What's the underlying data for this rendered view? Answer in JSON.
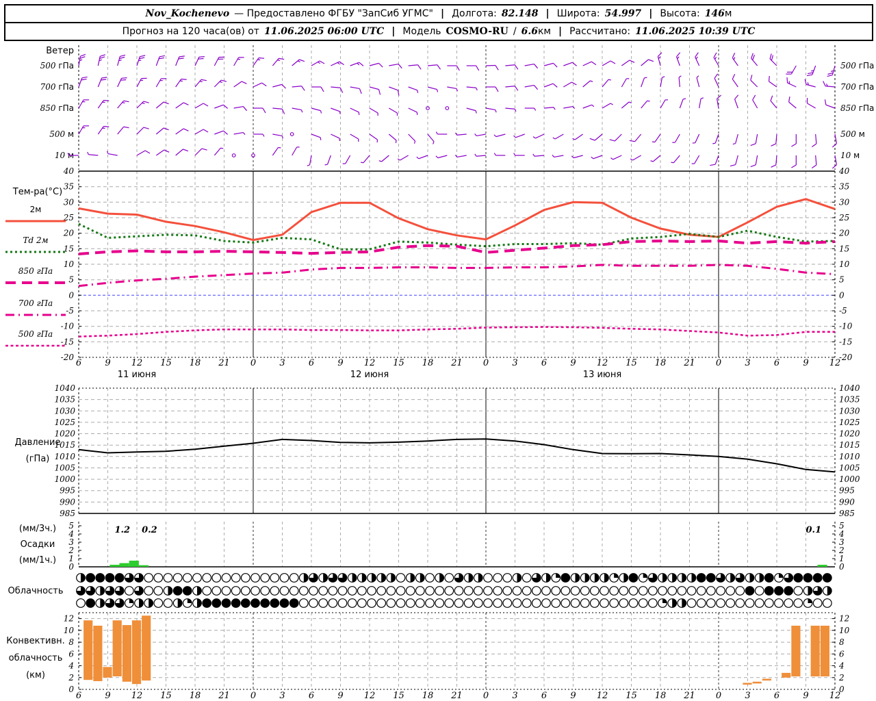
{
  "header": {
    "station": "Nov_Kochenevo",
    "provider": "— Предоставлено ФГБУ \"ЗапСиб УГМС\"",
    "separator": "|",
    "lon_label": "Долгота:",
    "lon": "82.148",
    "lat_label": "Широта:",
    "lat": "54.997",
    "alt_label": "Высота:",
    "alt_num": "146",
    "alt_unit": "м",
    "forecast_label": "Прогноз на 120 часа(ов) от",
    "forecast_start": "11.06.2025 06:00 UTC",
    "model_label": "Модель",
    "model": "COSMO-RU",
    "model_slash": "/",
    "model_res_num": "6.6",
    "model_res_unit": "км",
    "calc_label": "Рассчитано:",
    "calc_time": "11.06.2025 10:39 UTC"
  },
  "colors": {
    "barb": "#8a00c8",
    "temp_2m": "#f4503c",
    "dewpoint": "#157815",
    "magenta": "#e6008c",
    "zero_line": "#4444ff",
    "grid": "#aaaaaa",
    "pressure_line": "#000000",
    "precip_bar": "#2ecc2e",
    "conv_bar": "#ef8f3a"
  },
  "chart_data": {
    "type": "meteogram",
    "x_axis": {
      "start_label_hour": 6,
      "span_hours": 78,
      "tick_step_hours": 3,
      "hour_labels": [
        "6",
        "9",
        "12",
        "15",
        "18",
        "21",
        "0",
        "3",
        "6",
        "9",
        "12",
        "15",
        "18",
        "21",
        "0",
        "3",
        "6",
        "9",
        "12",
        "15",
        "18",
        "21",
        "0",
        "3",
        "6",
        "9",
        "12"
      ],
      "date_labels": [
        {
          "text": "11 июня",
          "t": 6
        },
        {
          "text": "12 июня",
          "t": 30
        },
        {
          "text": "13 июня",
          "t": 54
        }
      ]
    },
    "wind": {
      "title": "Ветер",
      "levels": [
        "500 гПа",
        "700 гПа",
        "850 гПа",
        "500 м",
        "10 м"
      ],
      "barb_step_hours": 2,
      "barbs": [
        {
          "level": "500 гПа",
          "dirs": [
            10,
            12,
            15,
            18,
            20,
            22,
            25,
            28,
            30,
            35,
            40,
            50,
            60,
            65,
            70,
            75,
            80,
            85,
            85,
            90,
            90,
            88,
            85,
            80,
            75,
            70,
            65,
            60,
            55,
            50,
            345,
            340,
            335,
            330,
            325,
            320,
            315,
            210,
            200,
            195
          ],
          "spds": [
            25,
            25,
            25,
            25,
            20,
            20,
            20,
            20,
            15,
            15,
            15,
            15,
            15,
            15,
            15,
            10,
            10,
            10,
            10,
            10,
            10,
            10,
            10,
            10,
            10,
            10,
            10,
            10,
            10,
            10,
            15,
            15,
            15,
            15,
            15,
            20,
            20,
            20,
            25,
            25
          ]
        },
        {
          "level": "700 гПа",
          "dirs": [
            20,
            22,
            25,
            28,
            30,
            35,
            40,
            45,
            55,
            65,
            75,
            85,
            90,
            95,
            100,
            105,
            110,
            110,
            105,
            100,
            95,
            90,
            85,
            80,
            70,
            60,
            50,
            40,
            30,
            20,
            10,
            355,
            345,
            335,
            325,
            315,
            305,
            295,
            285,
            275
          ],
          "spds": [
            20,
            20,
            20,
            15,
            15,
            15,
            15,
            15,
            10,
            10,
            10,
            10,
            10,
            10,
            10,
            10,
            10,
            5,
            5,
            5,
            5,
            10,
            10,
            10,
            10,
            10,
            5,
            5,
            5,
            5,
            5,
            5,
            5,
            10,
            10,
            10,
            10,
            15,
            15,
            15
          ]
        },
        {
          "level": "850 гПа",
          "dirs": [
            30,
            35,
            40,
            45,
            50,
            55,
            60,
            70,
            80,
            90,
            95,
            100,
            105,
            110,
            115,
            120,
            120,
            115,
            0,
            0,
            105,
            100,
            95,
            90,
            85,
            80,
            70,
            60,
            50,
            40,
            30,
            20,
            10,
            350,
            340,
            330,
            320,
            310,
            300,
            290
          ],
          "spds": [
            15,
            15,
            15,
            15,
            10,
            10,
            10,
            10,
            10,
            10,
            10,
            5,
            5,
            5,
            5,
            5,
            5,
            5,
            0,
            0,
            5,
            5,
            5,
            5,
            5,
            5,
            5,
            5,
            5,
            5,
            5,
            5,
            5,
            10,
            10,
            10,
            10,
            10,
            10,
            10
          ]
        },
        {
          "level": "500 м",
          "dirs": [
            30,
            35,
            40,
            45,
            50,
            55,
            60,
            70,
            80,
            90,
            100,
            0,
            110,
            115,
            120,
            125,
            130,
            135,
            140,
            270,
            265,
            260,
            255,
            250,
            245,
            240,
            235,
            230,
            225,
            220,
            215,
            210,
            205,
            200,
            195,
            190,
            185,
            180,
            175,
            170
          ],
          "spds": [
            15,
            15,
            10,
            10,
            10,
            10,
            10,
            10,
            5,
            5,
            5,
            0,
            5,
            5,
            5,
            5,
            5,
            5,
            5,
            5,
            5,
            5,
            5,
            5,
            5,
            5,
            5,
            10,
            10,
            10,
            5,
            5,
            5,
            5,
            5,
            10,
            10,
            10,
            10,
            10
          ]
        },
        {
          "level": "10 м",
          "dirs": [
            270,
            275,
            280,
            60,
            55,
            50,
            45,
            40,
            0,
            0,
            35,
            30,
            190,
            200,
            210,
            220,
            230,
            240,
            250,
            255,
            260,
            265,
            270,
            270,
            265,
            260,
            255,
            250,
            245,
            240,
            230,
            220,
            210,
            200,
            195,
            190,
            185,
            180,
            175,
            170
          ],
          "spds": [
            5,
            5,
            5,
            10,
            10,
            10,
            10,
            5,
            0,
            0,
            5,
            5,
            5,
            5,
            5,
            5,
            5,
            5,
            5,
            5,
            5,
            5,
            5,
            5,
            5,
            5,
            5,
            5,
            5,
            5,
            5,
            5,
            5,
            10,
            10,
            10,
            10,
            10,
            10,
            10
          ]
        }
      ]
    },
    "temperature": {
      "title": "Тем-ра(°C)",
      "ylim": [
        -20,
        40
      ],
      "ytick": 5,
      "step_hours": 3,
      "series": [
        {
          "name": "2м",
          "style": "solid",
          "color_key": "temp_2m",
          "values": [
            28,
            26.3,
            26,
            23.7,
            22.3,
            20.3,
            17.8,
            19.5,
            26.8,
            29.8,
            29.8,
            24.8,
            21.3,
            19.3,
            18,
            22.5,
            27.5,
            30,
            29.8,
            25,
            21.5,
            19.5,
            18.8,
            23.5,
            28.5,
            31,
            27.8
          ]
        },
        {
          "name": "Td 2м",
          "style": "dotted",
          "color_key": "dewpoint",
          "values": [
            23,
            18.5,
            19,
            19.5,
            19.3,
            17.5,
            17,
            18.5,
            18,
            14.8,
            14.8,
            17.3,
            17,
            16.3,
            15.8,
            16.5,
            16.5,
            16.8,
            16.3,
            18.3,
            18.8,
            19.8,
            18.8,
            20.8,
            18.8,
            17.3,
            17.5
          ]
        },
        {
          "name": "850 гПа",
          "style": "longdash",
          "color_key": "magenta",
          "values": [
            13.3,
            14,
            14.3,
            14,
            14,
            14.2,
            14,
            13.8,
            13.5,
            13.8,
            14,
            15.5,
            16,
            15.8,
            13.8,
            14.5,
            15.2,
            16,
            16.3,
            17.3,
            17.5,
            17.3,
            17.5,
            16.8,
            17.3,
            16.8,
            17.3
          ]
        },
        {
          "name": "700 гПа",
          "style": "dashdot",
          "color_key": "magenta",
          "values": [
            3,
            4,
            4.8,
            5.3,
            6,
            6.5,
            7,
            7.3,
            8.3,
            8.8,
            8.8,
            9,
            9,
            8.8,
            8.8,
            9,
            9,
            9.3,
            9.8,
            9.5,
            9.5,
            9.5,
            9.8,
            9.5,
            8.5,
            7.3,
            6.8
          ]
        },
        {
          "name": "500 гПа",
          "style": "shortdash",
          "color_key": "magenta",
          "values": [
            -13.3,
            -13,
            -12.5,
            -11.8,
            -11.3,
            -11,
            -11,
            -11,
            -11.2,
            -11.2,
            -11.3,
            -11.3,
            -11,
            -10.8,
            -10.4,
            -10.3,
            -10.2,
            -10.3,
            -10.5,
            -10.8,
            -11,
            -11.5,
            -12,
            -13,
            -12.8,
            -11.8,
            -11.8
          ]
        }
      ]
    },
    "pressure": {
      "title_lines": [
        "Давление",
        "(гПа)"
      ],
      "ylim": [
        985,
        1040
      ],
      "ytick": 5,
      "step_hours": 3,
      "values": [
        1013,
        1011.6,
        1012,
        1012.3,
        1013.2,
        1014.5,
        1015.8,
        1017.5,
        1017,
        1016.2,
        1016,
        1016.3,
        1016.8,
        1017.5,
        1017.7,
        1016.8,
        1015.2,
        1013,
        1011.3,
        1011.2,
        1011.3,
        1010.7,
        1010,
        1008.8,
        1006.8,
        1004.3,
        1003.2
      ]
    },
    "precipitation": {
      "labels_left": [
        "(мм/3ч.)",
        "Осадки",
        "(мм/1ч.)"
      ],
      "ylim": [
        0,
        5
      ],
      "bars": [
        {
          "t": 3.2,
          "v": 0.25
        },
        {
          "t": 4.2,
          "v": 0.45
        },
        {
          "t": 5.2,
          "v": 0.75
        },
        {
          "t": 6.2,
          "v": 0.2
        },
        {
          "t": 76.2,
          "v": 0.25
        }
      ],
      "annotations": [
        {
          "text": "1.2",
          "t": 4.5
        },
        {
          "text": "0.2",
          "t": 7.3
        },
        {
          "text": "0.1",
          "t": 75.8
        }
      ]
    },
    "cloudiness": {
      "label": "Облачность",
      "rows": [
        [
          0.5,
          1,
          1,
          1,
          1,
          0.75,
          0.75,
          0,
          0,
          0,
          0,
          0,
          0,
          0,
          0,
          0,
          0,
          0,
          0,
          0,
          0,
          0,
          0,
          0.5,
          0.75,
          0.5,
          0.75,
          0.75,
          0.5,
          0.5,
          0.5,
          0.5,
          0.5,
          0,
          0.5,
          0.5,
          0,
          0.5,
          0,
          0.75,
          0.5,
          0.5,
          0,
          0,
          0,
          0.5,
          0,
          0.75,
          0.5,
          0.25,
          1,
          0.5,
          0.5,
          0.5,
          0.5,
          0.25,
          0.5,
          1,
          0.25,
          0.75,
          0.5,
          0.5,
          0.5,
          0.5,
          1,
          1,
          0.75,
          0.5,
          0.75,
          0.5,
          0.5,
          1,
          0.25,
          0.75,
          1,
          1,
          1,
          1
        ],
        [
          0.75,
          0.75,
          0.5,
          0.75,
          0.75,
          0,
          0.75,
          0,
          0,
          0.5,
          1,
          1,
          0.5,
          0,
          0,
          0,
          0,
          0,
          0,
          0,
          0,
          0,
          0,
          0,
          0,
          0,
          0,
          0,
          0,
          0,
          0,
          0,
          0,
          0,
          0,
          0,
          0,
          0,
          0,
          0,
          0,
          0,
          0,
          0,
          0,
          0,
          0,
          0,
          0,
          0,
          0,
          0,
          0,
          0,
          0,
          0,
          0,
          0,
          0,
          0,
          0,
          0,
          0,
          0,
          0,
          0,
          0,
          0,
          0,
          1,
          0,
          1,
          1,
          1,
          0,
          0.5,
          0.75,
          0.5
        ],
        [
          0,
          1,
          0.5,
          0.75,
          0.75,
          0.25,
          0.5,
          0.5,
          0,
          0,
          0.5,
          0.25,
          0.5,
          1,
          1,
          1,
          1,
          1,
          1,
          1,
          1,
          1,
          1,
          0,
          0,
          0,
          0,
          0,
          0,
          0,
          0,
          0,
          0,
          0,
          0,
          0,
          0,
          0,
          0,
          0,
          0,
          0,
          0,
          0,
          0,
          0,
          0,
          0,
          0,
          0,
          0,
          0,
          0,
          0,
          0,
          0,
          0,
          0,
          0,
          0,
          0.25,
          0.5,
          0.5,
          0,
          0,
          0,
          0,
          0,
          0,
          0,
          0,
          0,
          0,
          0,
          0,
          0.25,
          0,
          0
        ]
      ]
    },
    "convective": {
      "labels_left": [
        "Конвективн.",
        "облачность",
        "(км)"
      ],
      "ylim": [
        0,
        12
      ],
      "ytick": 2,
      "bars": [
        {
          "t": 1,
          "lo": 1.6,
          "hi": 11.7
        },
        {
          "t": 2,
          "lo": 1.4,
          "hi": 10.8
        },
        {
          "t": 3,
          "lo": 2,
          "hi": 3.8
        },
        {
          "t": 4,
          "lo": 2.2,
          "hi": 11.7
        },
        {
          "t": 5,
          "lo": 1.3,
          "hi": 10.9
        },
        {
          "t": 6,
          "lo": 0.9,
          "hi": 11.7
        },
        {
          "t": 7,
          "lo": 1.5,
          "hi": 12.5
        },
        {
          "t": 69,
          "lo": 0.8,
          "hi": 1.1
        },
        {
          "t": 70,
          "lo": 1,
          "hi": 1.3
        },
        {
          "t": 71,
          "lo": 1.5,
          "hi": 1.8
        },
        {
          "t": 73,
          "lo": 2,
          "hi": 2.8
        },
        {
          "t": 74,
          "lo": 2.2,
          "hi": 10.8
        },
        {
          "t": 76,
          "lo": 2.2,
          "hi": 10.8
        },
        {
          "t": 77,
          "lo": 2.2,
          "hi": 10.8
        }
      ]
    }
  }
}
